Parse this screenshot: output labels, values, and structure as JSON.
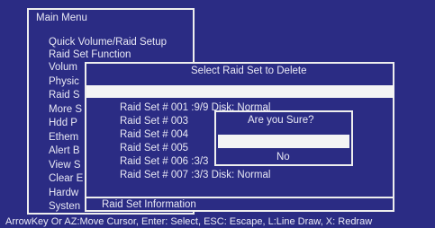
{
  "main_menu": {
    "title": "Main Menu",
    "items": [
      "Quick Volume/Raid Setup",
      "Raid Set Function",
      "Volum",
      "Physic",
      "Raid S",
      "More S",
      "Hdd P",
      "Ethem",
      "Alert B",
      "View S",
      "Clear E",
      "Hardw",
      "Systen"
    ]
  },
  "select_dialog": {
    "title": "Select Raid Set to Delete",
    "items": [
      "Raid Set # 001 :9/9  Disk: Normal",
      "Raid Set # 003",
      "Raid Set # 004",
      "Raid Set # 005",
      "Raid Set # 006 :3/3",
      "Raid Set # 007 :3/3  Disk: Normal"
    ],
    "footer": "Raid Set Information"
  },
  "confirm_dialog": {
    "title": "Are you Sure?",
    "yes_label": "",
    "no_label": "No"
  },
  "status_bar": {
    "text": "ArrowKey Or AZ:Move Cursor, Enter: Select, ESC: Escape, L:Line Draw, X: Redraw"
  },
  "colors": {
    "background": "#2b2c84",
    "highlight": "#f4f4f4",
    "text": "#e8e8f4"
  }
}
